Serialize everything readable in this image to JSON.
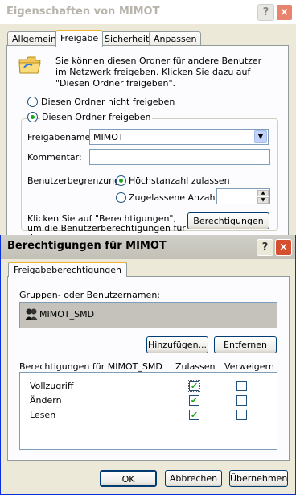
{
  "back_dialog": {
    "title": "Eigenschaften von MIMOT",
    "help_glyph": "?",
    "close_glyph": "×",
    "tabs": [
      "Allgemein",
      "Freigabe",
      "Sicherheit",
      "Anpassen"
    ],
    "active_tab": "Freigabe",
    "intro_text": "Sie können diesen Ordner für andere Benutzer im Netzwerk freigeben. Klicken Sie dazu auf \"Diesen Ordner freigeben\".",
    "radio_not_shared": "Diesen Ordner nicht freigeben",
    "radio_shared": "Diesen Ordner freigeben",
    "share_name_label": "Freigabename:",
    "share_name_value": "MIMOT",
    "comment_label": "Kommentar:",
    "comment_value": "",
    "user_limit_label": "Benutzerbegrenzung:",
    "radio_max": "Höchstanzahl zulassen",
    "radio_allowed": "Zugelassene Anzahl:",
    "allowed_count_value": "",
    "permissions_text": "Klicken Sie auf \"Berechtigungen\", um die Benutzerberechtigungen für den",
    "permissions_button": "Berechtigungen"
  },
  "front_dialog": {
    "title": "Berechtigungen für MIMOT",
    "help_glyph": "?",
    "close_glyph": "×",
    "tab": "Freigabeberechtigungen",
    "group_label": "Gruppen- oder Benutzernamen:",
    "users": [
      "MIMOT_SMD"
    ],
    "add_button": "Hinzufügen...",
    "remove_button": "Entfernen",
    "permissions_header": "Berechtigungen für MIMOT_SMD",
    "allow_header": "Zulassen",
    "deny_header": "Verweigern",
    "permissions": [
      {
        "name": "Vollzugriff",
        "allow": true,
        "deny": false
      },
      {
        "name": "Ändern",
        "allow": true,
        "deny": false
      },
      {
        "name": "Lesen",
        "allow": true,
        "deny": false
      }
    ],
    "ok_button": "OK",
    "cancel_button": "Abbrechen",
    "apply_button": "Übernehmen",
    "check_glyph": "✔"
  }
}
